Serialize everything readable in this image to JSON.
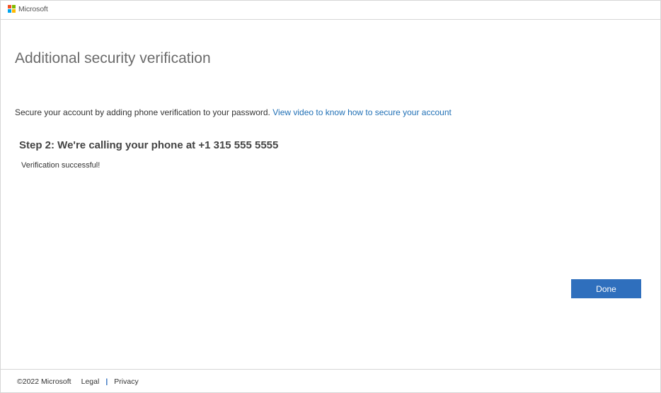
{
  "brand": {
    "name": "Microsoft",
    "logo_colors": [
      "#f25022",
      "#7fba00",
      "#00a4ef",
      "#ffb900"
    ]
  },
  "page": {
    "title": "Additional security verification",
    "intro_text": "Secure your account by adding phone verification to your password.",
    "intro_link": "View video to know how to secure your account"
  },
  "step": {
    "heading": "Step 2: We're calling your phone at +1 315 555 5555",
    "status": "Verification successful!"
  },
  "actions": {
    "done_label": "Done"
  },
  "footer": {
    "copyright": "©2022 Microsoft",
    "legal": "Legal",
    "separator": "|",
    "privacy": "Privacy"
  },
  "colors": {
    "accent": "#2f6fbd",
    "link": "#1f6fb5"
  }
}
